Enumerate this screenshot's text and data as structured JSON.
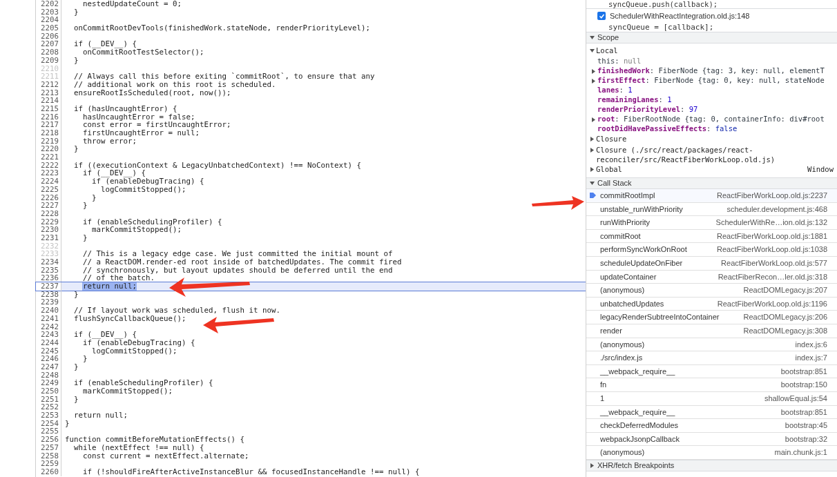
{
  "editor": {
    "lines": [
      {
        "number": "2202",
        "text": "    nestedUpdateCount = 0;",
        "dim": false,
        "current": false
      },
      {
        "number": "2203",
        "text": "  }",
        "dim": false,
        "current": false
      },
      {
        "number": "2204",
        "dim": false,
        "current": false
      },
      {
        "number": "2205",
        "text": "  onCommitRootDevTools(finishedWork.stateNode, renderPriorityLevel);",
        "dim": false,
        "current": false
      },
      {
        "number": "2206",
        "dim": false,
        "current": false
      },
      {
        "number": "2207",
        "text": "  if (__DEV__) {",
        "dim": false,
        "current": false
      },
      {
        "number": "2208",
        "text": "    onCommitRootTestSelector();",
        "dim": false,
        "current": false
      },
      {
        "number": "2209",
        "text": "  }",
        "dim": false,
        "current": false
      },
      {
        "number": "2210",
        "dim": true,
        "current": false
      },
      {
        "number": "2211",
        "text": "  // Always call this before exiting `commitRoot`, to ensure that any",
        "dim": true,
        "current": false
      },
      {
        "number": "2212",
        "text": "  // additional work on this root is scheduled.",
        "dim": false,
        "current": false
      },
      {
        "number": "2213",
        "text": "  ensureRootIsScheduled(root, now());",
        "dim": false,
        "current": false
      },
      {
        "number": "2214",
        "dim": false,
        "current": false
      },
      {
        "number": "2215",
        "text": "  if (hasUncaughtError) {",
        "dim": false,
        "current": false
      },
      {
        "number": "2216",
        "text": "    hasUncaughtError = false;",
        "dim": false,
        "current": false
      },
      {
        "number": "2217",
        "text": "    const error = firstUncaughtError;",
        "dim": false,
        "current": false
      },
      {
        "number": "2218",
        "text": "    firstUncaughtError = null;",
        "dim": false,
        "current": false
      },
      {
        "number": "2219",
        "text": "    throw error;",
        "dim": false,
        "current": false
      },
      {
        "number": "2220",
        "text": "  }",
        "dim": false,
        "current": false
      },
      {
        "number": "2221",
        "dim": false,
        "current": false
      },
      {
        "number": "2222",
        "text": "  if ((executionContext & LegacyUnbatchedContext) !== NoContext) {",
        "dim": false,
        "current": false
      },
      {
        "number": "2223",
        "text": "    if (__DEV__) {",
        "dim": false,
        "current": false
      },
      {
        "number": "2224",
        "text": "      if (enableDebugTracing) {",
        "dim": false,
        "current": false
      },
      {
        "number": "2225",
        "text": "        logCommitStopped();",
        "dim": false,
        "current": false
      },
      {
        "number": "2226",
        "text": "      }",
        "dim": false,
        "current": false
      },
      {
        "number": "2227",
        "text": "    }",
        "dim": false,
        "current": false
      },
      {
        "number": "2228",
        "dim": false,
        "current": false
      },
      {
        "number": "2229",
        "text": "    if (enableSchedulingProfiler) {",
        "dim": false,
        "current": false
      },
      {
        "number": "2230",
        "text": "      markCommitStopped();",
        "dim": false,
        "current": false
      },
      {
        "number": "2231",
        "text": "    }",
        "dim": false,
        "current": false
      },
      {
        "number": "2232",
        "dim": true,
        "current": false
      },
      {
        "number": "2233",
        "text": "    // This is a legacy edge case. We just committed the initial mount of",
        "dim": true,
        "current": false
      },
      {
        "number": "2234",
        "text": "    // a ReactDOM.render-ed root inside of batchedUpdates. The commit fired",
        "dim": false,
        "current": false
      },
      {
        "number": "2235",
        "text": "    // synchronously, but layout updates should be deferred until the end",
        "dim": false,
        "current": false
      },
      {
        "number": "2236",
        "text": "    // of the batch.",
        "dim": false,
        "current": false
      },
      {
        "number": "2237",
        "text": "    return null;",
        "dim": false,
        "current": true
      },
      {
        "number": "2238",
        "text": "  }",
        "dim": false,
        "current": false
      },
      {
        "number": "2239",
        "dim": false,
        "current": false
      },
      {
        "number": "2240",
        "text": "  // If layout work was scheduled, flush it now.",
        "dim": false,
        "current": false
      },
      {
        "number": "2241",
        "text": "  flushSyncCallbackQueue();",
        "dim": false,
        "current": false
      },
      {
        "number": "2242",
        "dim": false,
        "current": false
      },
      {
        "number": "2243",
        "text": "  if (__DEV__) {",
        "dim": false,
        "current": false
      },
      {
        "number": "2244",
        "text": "    if (enableDebugTracing) {",
        "dim": false,
        "current": false
      },
      {
        "number": "2245",
        "text": "      logCommitStopped();",
        "dim": false,
        "current": false
      },
      {
        "number": "2246",
        "text": "    }",
        "dim": false,
        "current": false
      },
      {
        "number": "2247",
        "text": "  }",
        "dim": false,
        "current": false
      },
      {
        "number": "2248",
        "dim": false,
        "current": false
      },
      {
        "number": "2249",
        "text": "  if (enableSchedulingProfiler) {",
        "dim": false,
        "current": false
      },
      {
        "number": "2250",
        "text": "    markCommitStopped();",
        "dim": false,
        "current": false
      },
      {
        "number": "2251",
        "text": "  }",
        "dim": false,
        "current": false
      },
      {
        "number": "2252",
        "dim": false,
        "current": false
      },
      {
        "number": "2253",
        "text": "  return null;",
        "dim": false,
        "current": false
      },
      {
        "number": "2254",
        "text": "}",
        "dim": false,
        "current": false
      },
      {
        "number": "2255",
        "dim": false,
        "current": false
      },
      {
        "number": "2256",
        "text": "function commitBeforeMutationEffects() {",
        "dim": false,
        "current": false
      },
      {
        "number": "2257",
        "text": "  while (nextEffect !== null) {",
        "dim": false,
        "current": false
      },
      {
        "number": "2258",
        "text": "    const current = nextEffect.alternate;",
        "dim": false,
        "current": false
      },
      {
        "number": "2259",
        "dim": false,
        "current": false
      },
      {
        "number": "2260",
        "text": "    if (!shouldFireAfterActiveInstanceBlur && focusedInstanceHandle !== null) {",
        "dim": false,
        "current": false
      }
    ]
  },
  "breakpoints": {
    "partial_line": "syncQueue.push(callback);",
    "items": [
      {
        "file": "SchedulerWithReactIntegration.old.js:148",
        "code": "syncQueue = [callback];",
        "checked": true
      }
    ]
  },
  "scope": {
    "title": "Scope",
    "expanded": true,
    "separator": ":",
    "groups": [
      {
        "label": "Local",
        "expanded": true,
        "props": [
          {
            "name": "this",
            "value": "null",
            "own": false,
            "expandable": false,
            "kind": "null"
          },
          {
            "name": "finishedWork",
            "value": "FiberNode {tag: 3, key: null, elementT",
            "own": true,
            "expandable": true,
            "kind": "object"
          },
          {
            "name": "firstEffect",
            "value": "FiberNode {tag: 0, key: null, stateNode",
            "own": true,
            "expandable": true,
            "kind": "object"
          },
          {
            "name": "lanes",
            "value": "1",
            "own": true,
            "expandable": false,
            "kind": "number"
          },
          {
            "name": "remainingLanes",
            "value": "1",
            "own": true,
            "expandable": false,
            "kind": "number"
          },
          {
            "name": "renderPriorityLevel",
            "value": "97",
            "own": true,
            "expandable": false,
            "kind": "number"
          },
          {
            "name": "root",
            "value": "FiberRootNode {tag: 0, containerInfo: div#root",
            "own": true,
            "expandable": true,
            "kind": "object"
          },
          {
            "name": "rootDidHavePassiveEffects",
            "value": "false",
            "own": true,
            "expandable": false,
            "kind": "boolean"
          }
        ]
      },
      {
        "label": "Closure",
        "expanded": false
      },
      {
        "label": "Closure (./src/react/packages/react-reconciler/src/ReactFiberWorkLoop.old.js)",
        "expanded": false
      },
      {
        "label": "Global",
        "value": "Window",
        "expanded": false
      }
    ]
  },
  "call_stack": {
    "title": "Call Stack",
    "expanded": true,
    "frames": [
      {
        "function": "commitRootImpl",
        "location": "ReactFiberWorkLoop.old.js:2237",
        "selected": true
      },
      {
        "function": "unstable_runWithPriority",
        "location": "scheduler.development.js:468",
        "selected": false
      },
      {
        "function": "runWithPriority",
        "location": "SchedulerWithRe…ion.old.js:132",
        "selected": false
      },
      {
        "function": "commitRoot",
        "location": "ReactFiberWorkLoop.old.js:1881",
        "selected": false
      },
      {
        "function": "performSyncWorkOnRoot",
        "location": "ReactFiberWorkLoop.old.js:1038",
        "selected": false
      },
      {
        "function": "scheduleUpdateOnFiber",
        "location": "ReactFiberWorkLoop.old.js:577",
        "selected": false
      },
      {
        "function": "updateContainer",
        "location": "ReactFiberRecon…ler.old.js:318",
        "selected": false
      },
      {
        "function": "(anonymous)",
        "location": "ReactDOMLegacy.js:207",
        "selected": false
      },
      {
        "function": "unbatchedUpdates",
        "location": "ReactFiberWorkLoop.old.js:1196",
        "selected": false
      },
      {
        "function": "legacyRenderSubtreeIntoContainer",
        "location": "ReactDOMLegacy.js:206",
        "selected": false
      },
      {
        "function": "render",
        "location": "ReactDOMLegacy.js:308",
        "selected": false
      },
      {
        "function": "(anonymous)",
        "location": "index.js:6",
        "selected": false
      },
      {
        "function": "./src/index.js",
        "location": "index.js:7",
        "selected": false
      },
      {
        "function": "__webpack_require__",
        "location": "bootstrap:851",
        "selected": false
      },
      {
        "function": "fn",
        "location": "bootstrap:150",
        "selected": false
      },
      {
        "function": "1",
        "location": "shallowEqual.js:54",
        "selected": false
      },
      {
        "function": "__webpack_require__",
        "location": "bootstrap:851",
        "selected": false
      },
      {
        "function": "checkDeferredModules",
        "location": "bootstrap:45",
        "selected": false
      },
      {
        "function": "webpackJsonpCallback",
        "location": "bootstrap:32",
        "selected": false
      },
      {
        "function": "(anonymous)",
        "location": "main.chunk.js:1",
        "selected": false
      }
    ]
  },
  "xhr_breakpoints": {
    "title": "XHR/fetch Breakpoints",
    "expanded": false
  }
}
